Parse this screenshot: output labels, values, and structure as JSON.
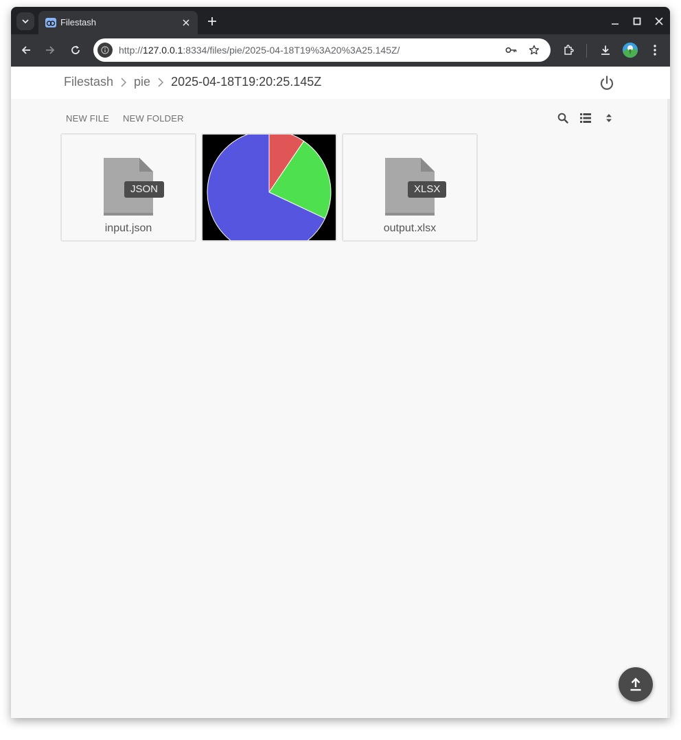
{
  "browser": {
    "tab": {
      "title": "Filestash"
    },
    "url": {
      "scheme": "http://",
      "host": "127.0.0.1",
      "rest": ":8334/files/pie/2025-04-18T19%3A20%3A25.145Z/"
    }
  },
  "app": {
    "breadcrumb": [
      {
        "label": "Filestash"
      },
      {
        "label": "pie"
      },
      {
        "label": "2025-04-18T19:20:25.145Z"
      }
    ],
    "actions": {
      "new_file": "NEW FILE",
      "new_folder": "NEW FOLDER"
    },
    "files": [
      {
        "name": "input.json",
        "ext": "JSON"
      },
      {
        "name": "pie-chart-image",
        "thumbnail": true
      },
      {
        "name": "output.xlsx",
        "ext": "XLSX"
      }
    ],
    "colors": {
      "slice_red": "#e05555",
      "slice_green": "#4fe04f",
      "slice_blue": "#5555e0",
      "icon_gray": "#a8a8a8"
    }
  }
}
